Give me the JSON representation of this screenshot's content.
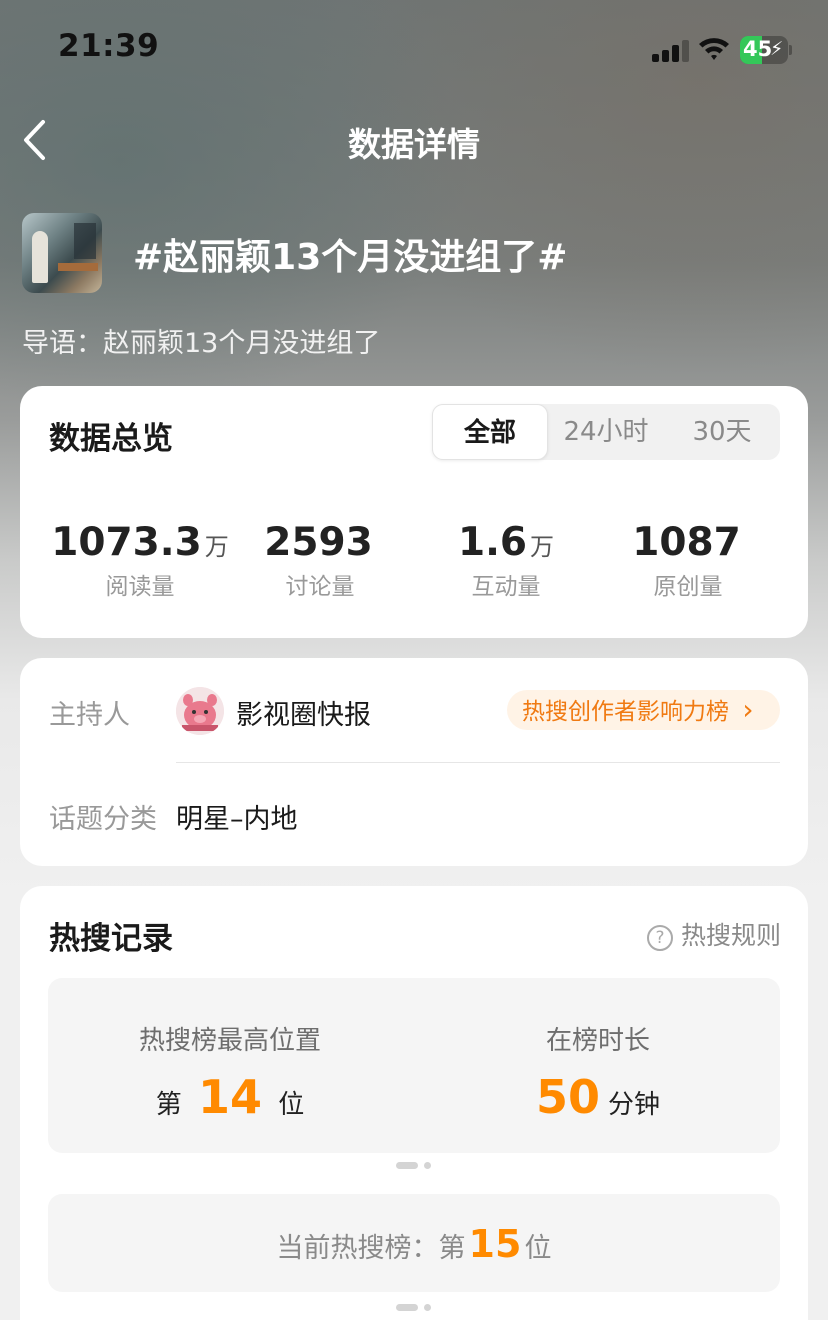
{
  "status_bar": {
    "time": "21:39",
    "battery": "45",
    "battery_level": 0.45
  },
  "nav": {
    "title": "数据详情"
  },
  "topic": {
    "title": "#赵丽颖13个月没进组了#",
    "intro_label": "导语：",
    "intro": "赵丽颖13个月没进组了"
  },
  "overview": {
    "title": "数据总览",
    "tabs": [
      "全部",
      "24小时",
      "30天"
    ],
    "active_tab": "全部",
    "stats": [
      {
        "value": "1073.3",
        "unit": "万",
        "label": "阅读量"
      },
      {
        "value": "2593",
        "unit": "",
        "label": "讨论量"
      },
      {
        "value": "1.6",
        "unit": "万",
        "label": "互动量"
      },
      {
        "value": "1087",
        "unit": "",
        "label": "原创量"
      }
    ]
  },
  "info": {
    "host_label": "主持人",
    "host_name": "影视圈快报",
    "rank_link": "热搜创作者影响力榜",
    "rank_chevron": "›",
    "category_label": "话题分类",
    "category": "明星–内地"
  },
  "hot_search": {
    "title": "热搜记录",
    "rules_label": "热搜规则",
    "rules_icon": "?",
    "peak_label": "热搜榜最高位置",
    "peak_prefix": "第",
    "peak_value": "14",
    "peak_suffix": "位",
    "duration_label": "在榜时长",
    "duration_value": "50",
    "duration_unit": "分钟",
    "current_label": "当前热搜榜：",
    "current_prefix": "第",
    "current_value": "15",
    "current_suffix": "位"
  },
  "colors": {
    "accent": "#ff8a00",
    "pill_bg": "#fff3e6",
    "pill_text": "#f07a12"
  }
}
